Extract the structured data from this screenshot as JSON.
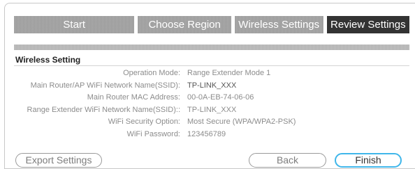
{
  "steps": [
    {
      "label": "Start"
    },
    {
      "label": "Choose Region"
    },
    {
      "label": "Wireless Settings"
    },
    {
      "label": "Review Settings"
    }
  ],
  "section": {
    "title": "Wireless Setting"
  },
  "settings": [
    {
      "label": "Operation Mode:",
      "value": "Range Extender Mode 1"
    },
    {
      "label": "Main Router/AP WiFi Network Name(SSID):",
      "value": "TP-LINK_XXX"
    },
    {
      "label": "Main Router MAC Address:",
      "value": "00-0A-EB-74-06-06"
    },
    {
      "label": "Range Extender WiFi Network Name(SSID)::",
      "value": "TP-LINK_XXX"
    },
    {
      "label": "WiFi Security Option:",
      "value": "Most Secure (WPA/WPA2-PSK)"
    },
    {
      "label": "WiFi Password:",
      "value": "123456789"
    }
  ],
  "buttons": {
    "export": "Export Settings",
    "back": "Back",
    "finish": "Finish"
  },
  "colors": {
    "active_step": "#333333",
    "inactive_step": "#a3a3a3",
    "finish_border": "#3fb6ea"
  }
}
